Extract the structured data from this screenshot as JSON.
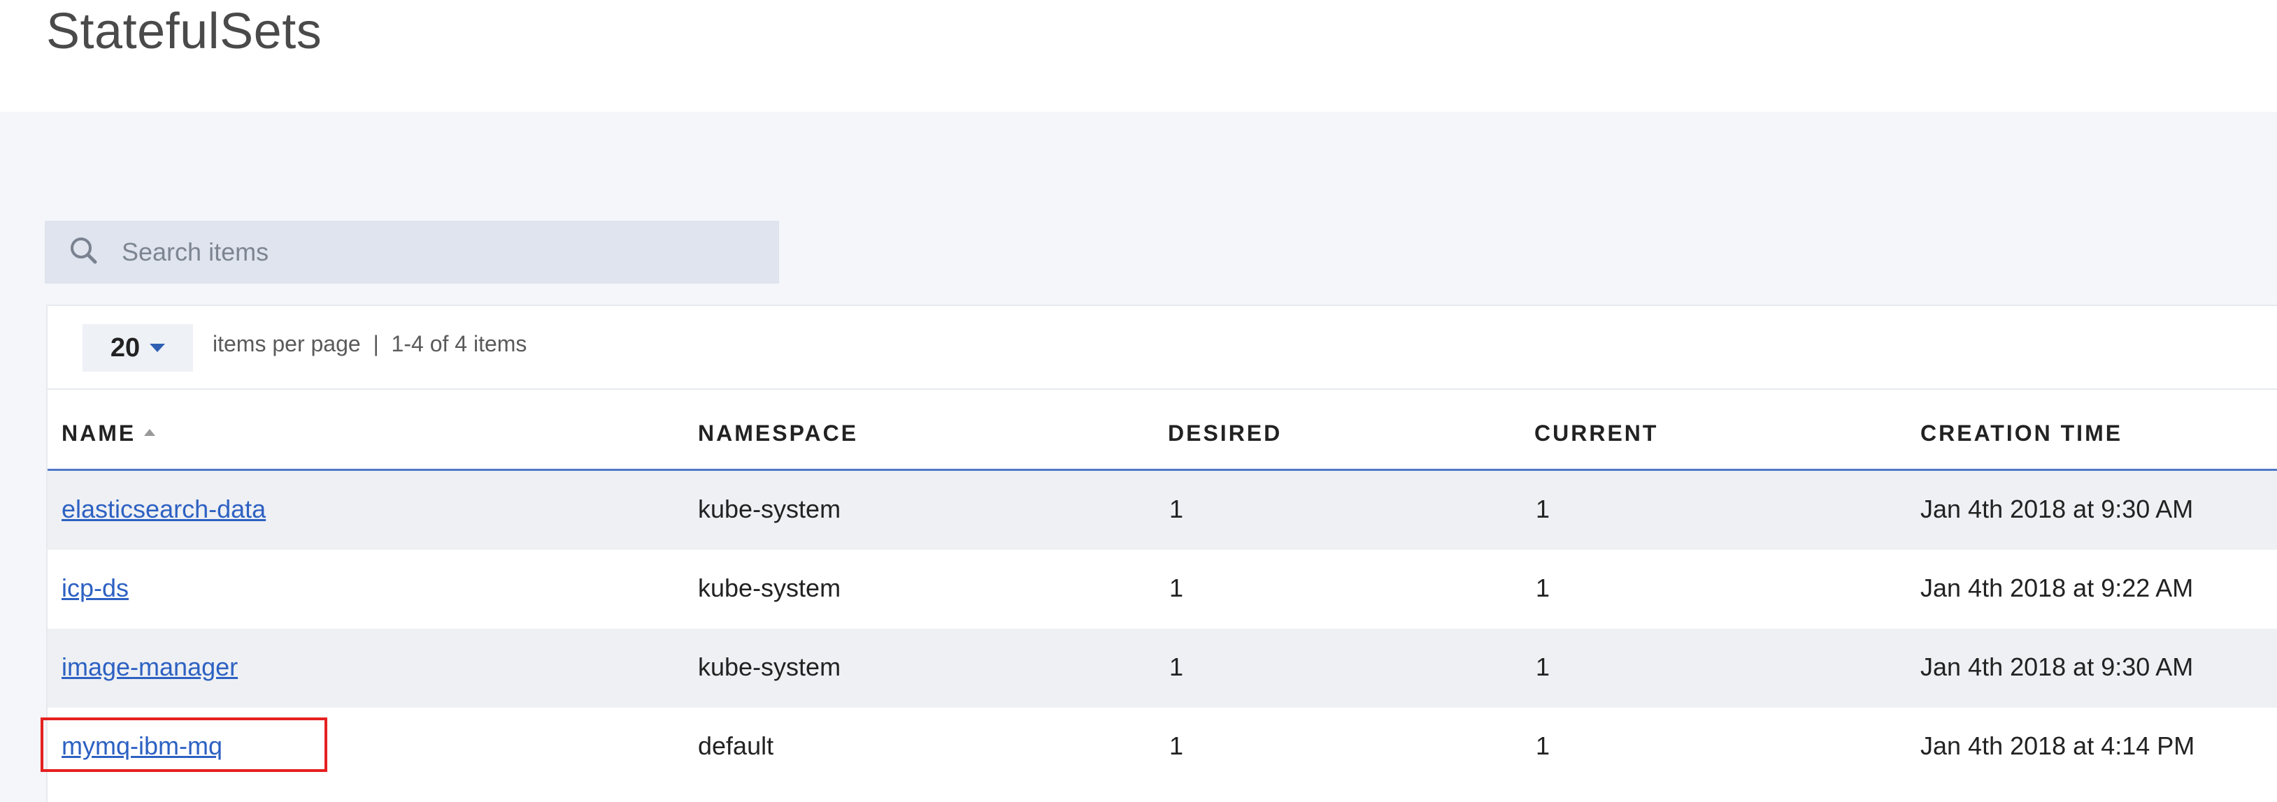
{
  "page": {
    "title": "StatefulSets"
  },
  "search": {
    "placeholder": "Search items",
    "value": ""
  },
  "pagination": {
    "per_page": "20",
    "summary": "items per page  |  1-4 of 4 items"
  },
  "table": {
    "headers": {
      "name": "NAME",
      "namespace": "NAMESPACE",
      "desired": "DESIRED",
      "current": "CURRENT",
      "creation_time": "CREATION TIME"
    },
    "sorted_by": "name",
    "rows": [
      {
        "name": "elasticsearch-data",
        "namespace": "kube-system",
        "desired": "1",
        "current": "1",
        "creation_time": "Jan 4th 2018 at 9:30 AM"
      },
      {
        "name": "icp-ds",
        "namespace": "kube-system",
        "desired": "1",
        "current": "1",
        "creation_time": "Jan 4th 2018 at 9:22 AM"
      },
      {
        "name": "image-manager",
        "namespace": "kube-system",
        "desired": "1",
        "current": "1",
        "creation_time": "Jan 4th 2018 at 9:30 AM"
      },
      {
        "name": "mymq-ibm-mq",
        "namespace": "default",
        "desired": "1",
        "current": "1",
        "creation_time": "Jan 4th 2018 at 4:14 PM",
        "highlighted": true
      }
    ]
  },
  "icons": {
    "search": "search-icon",
    "per_page_caret": "caret-down-icon",
    "sort": "sort-ascending-icon"
  },
  "colors": {
    "link": "#2d61c2",
    "header_underline": "#4f79c8",
    "highlight_box": "#e52020"
  }
}
